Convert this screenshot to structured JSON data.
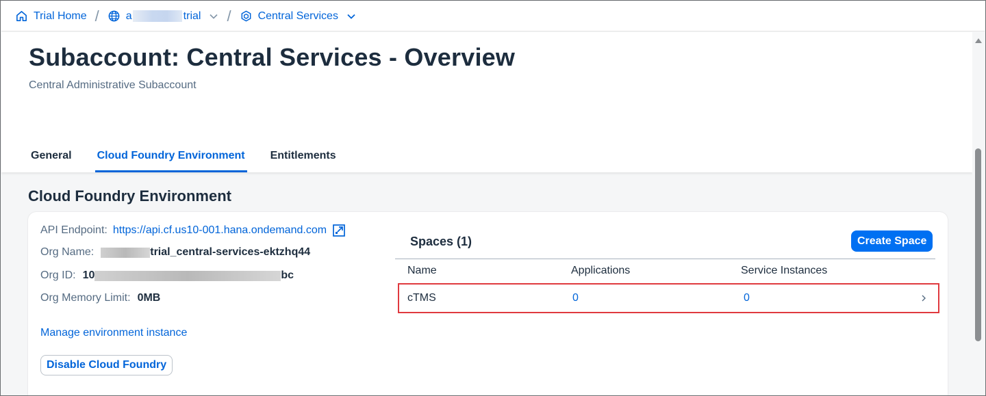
{
  "breadcrumb": {
    "home": "Trial Home",
    "global_account_prefix": "a",
    "global_account_suffix": "trial",
    "subaccount": "Central Services"
  },
  "header": {
    "title": "Subaccount: Central Services - Overview",
    "subtitle": "Central Administrative Subaccount",
    "tabs": [
      {
        "label": "General",
        "active": false
      },
      {
        "label": "Cloud Foundry Environment",
        "active": true
      },
      {
        "label": "Entitlements",
        "active": false
      }
    ]
  },
  "section": {
    "title": "Cloud Foundry Environment"
  },
  "env_info": {
    "api_endpoint_label": "API Endpoint:",
    "api_endpoint_value": "https://api.cf.us10-001.hana.ondemand.com",
    "org_name_label": "Org Name:",
    "org_name_suffix": "trial_central-services-ektzhq44",
    "org_id_label": "Org ID:",
    "org_id_prefix": "10",
    "org_id_suffix": "bc",
    "memory_label": "Org Memory Limit:",
    "memory_value": "0MB",
    "manage_link": "Manage environment instance",
    "disable_button": "Disable Cloud Foundry"
  },
  "spaces": {
    "title": "Spaces (1)",
    "create_button": "Create Space",
    "columns": [
      "Name",
      "Applications",
      "Service Instances"
    ],
    "rows": [
      {
        "name": "cTMS",
        "applications": "0",
        "service_instances": "0"
      }
    ]
  },
  "colors": {
    "brand": "#0064d9",
    "button_emphasized": "#0070f2",
    "highlight": "#e0393e"
  }
}
